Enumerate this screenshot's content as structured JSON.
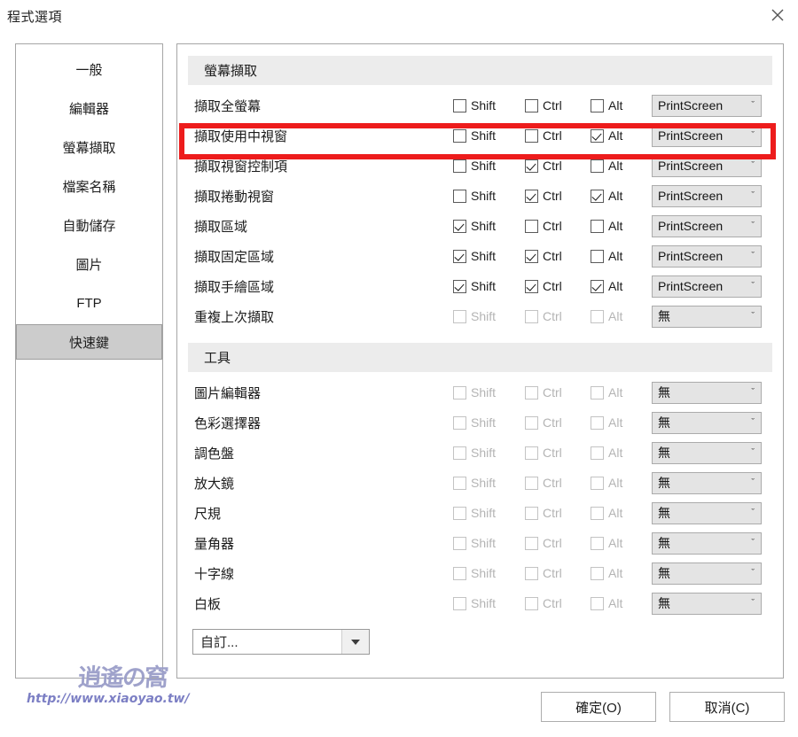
{
  "window": {
    "title": "程式選項",
    "close_icon": "close-icon"
  },
  "sidebar": {
    "items": [
      {
        "label": "一般",
        "selected": false
      },
      {
        "label": "編輯器",
        "selected": false
      },
      {
        "label": "螢幕擷取",
        "selected": false
      },
      {
        "label": "檔案名稱",
        "selected": false
      },
      {
        "label": "自動儲存",
        "selected": false
      },
      {
        "label": "圖片",
        "selected": false
      },
      {
        "label": "FTP",
        "selected": false
      },
      {
        "label": "快速鍵",
        "selected": true
      }
    ]
  },
  "modifiers": {
    "shift": "Shift",
    "ctrl": "Ctrl",
    "alt": "Alt"
  },
  "sections": [
    {
      "title": "螢幕擷取",
      "rows": [
        {
          "label": "擷取全螢幕",
          "shift": false,
          "ctrl": false,
          "alt": false,
          "key": "PrintScreen",
          "enabled": true,
          "highlighted": false
        },
        {
          "label": "擷取使用中視窗",
          "shift": false,
          "ctrl": false,
          "alt": true,
          "key": "PrintScreen",
          "enabled": true,
          "highlighted": true
        },
        {
          "label": "擷取視窗控制項",
          "shift": false,
          "ctrl": true,
          "alt": false,
          "key": "PrintScreen",
          "enabled": true,
          "highlighted": false
        },
        {
          "label": "擷取捲動視窗",
          "shift": false,
          "ctrl": true,
          "alt": true,
          "key": "PrintScreen",
          "enabled": true,
          "highlighted": false
        },
        {
          "label": "擷取區域",
          "shift": true,
          "ctrl": false,
          "alt": false,
          "key": "PrintScreen",
          "enabled": true,
          "highlighted": false
        },
        {
          "label": "擷取固定區域",
          "shift": true,
          "ctrl": true,
          "alt": false,
          "key": "PrintScreen",
          "enabled": true,
          "highlighted": false
        },
        {
          "label": "擷取手繪區域",
          "shift": true,
          "ctrl": true,
          "alt": true,
          "key": "PrintScreen",
          "enabled": true,
          "highlighted": false
        },
        {
          "label": "重複上次擷取",
          "shift": false,
          "ctrl": false,
          "alt": false,
          "key": "無",
          "enabled": false,
          "highlighted": false
        }
      ]
    },
    {
      "title": "工具",
      "rows": [
        {
          "label": "圖片編輯器",
          "shift": false,
          "ctrl": false,
          "alt": false,
          "key": "無",
          "enabled": false,
          "highlighted": false
        },
        {
          "label": "色彩選擇器",
          "shift": false,
          "ctrl": false,
          "alt": false,
          "key": "無",
          "enabled": false,
          "highlighted": false
        },
        {
          "label": "調色盤",
          "shift": false,
          "ctrl": false,
          "alt": false,
          "key": "無",
          "enabled": false,
          "highlighted": false
        },
        {
          "label": "放大鏡",
          "shift": false,
          "ctrl": false,
          "alt": false,
          "key": "無",
          "enabled": false,
          "highlighted": false
        },
        {
          "label": "尺規",
          "shift": false,
          "ctrl": false,
          "alt": false,
          "key": "無",
          "enabled": false,
          "highlighted": false
        },
        {
          "label": "量角器",
          "shift": false,
          "ctrl": false,
          "alt": false,
          "key": "無",
          "enabled": false,
          "highlighted": false
        },
        {
          "label": "十字線",
          "shift": false,
          "ctrl": false,
          "alt": false,
          "key": "無",
          "enabled": false,
          "highlighted": false
        },
        {
          "label": "白板",
          "shift": false,
          "ctrl": false,
          "alt": false,
          "key": "無",
          "enabled": false,
          "highlighted": false
        }
      ]
    }
  ],
  "custom_combo": {
    "value": "自訂...",
    "arrow_icon": "triangle-down-icon"
  },
  "footer": {
    "ok_label": "確定(O)",
    "cancel_label": "取消(C)"
  },
  "watermark": {
    "logo_text": "逍遙の窩",
    "url": "http://www.xiaoyao.tw/"
  },
  "colors": {
    "highlight_red": "#ed1c1c",
    "selected_sidebar": "#cccccc",
    "group_header_bg": "#ececec",
    "combo_bg": "#e4e4e4",
    "watermark_blue": "#7c7fc4"
  }
}
